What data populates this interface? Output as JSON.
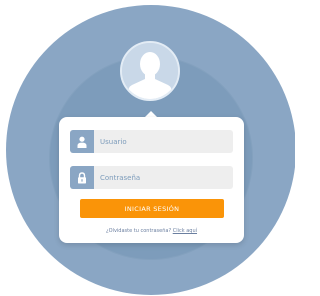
{
  "login": {
    "username_placeholder": "Usuario",
    "password_placeholder": "Contraseña",
    "submit_label": "INICIAR SESIÓN",
    "forgot_text": "¿Olvidaste tu contraseña?",
    "forgot_link": "Click aquí"
  },
  "icons": {
    "avatar": "user-silhouette-icon",
    "username": "user-icon",
    "password": "lock-icon"
  },
  "colors": {
    "outer_circle": "#8aa6c4",
    "inner_circle": "#7d9cbb",
    "icon_box": "#8aa6c4",
    "button": "#fa9408",
    "placeholder_text": "#7d9cbb"
  }
}
